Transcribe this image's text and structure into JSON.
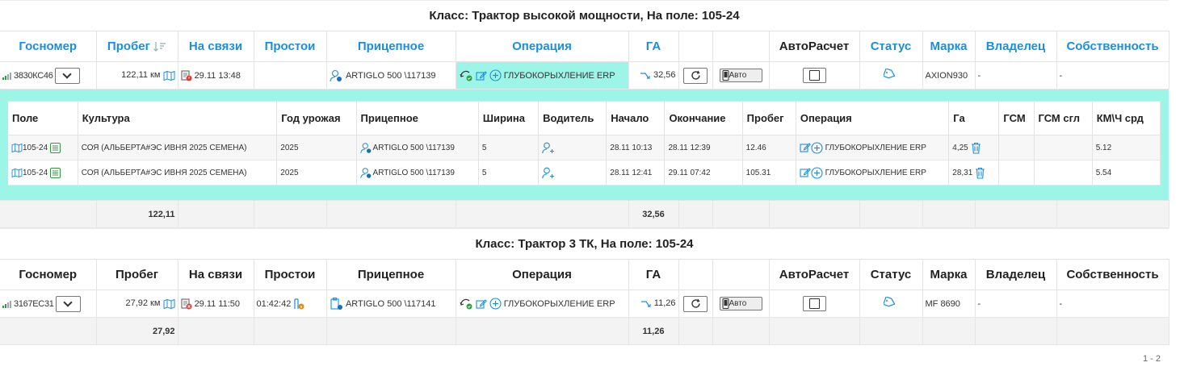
{
  "groups": [
    {
      "title": "Класс: Трактор высокой мощности, На поле: 105-24",
      "headers": {
        "gosnomer": "Госномер",
        "probeg": "Пробег",
        "na_svyazi": "На связи",
        "prostoi": "Простои",
        "pricepnoe": "Прицепное",
        "operaciya": "Операция",
        "ga": "ГА",
        "autocalc": "АвтоРасчет",
        "status": "Статус",
        "marka": "Марка",
        "vladelec": "Владелец",
        "sobstvennost": "Собственность"
      },
      "row": {
        "plate": "3830КС46",
        "probeg": "122,11 км",
        "na_svyazi": "29.11 13:48",
        "prostoi": "",
        "pricepnoe": "ARTIGLO 500 \\117139",
        "operaciya": "ГЛУБОКОРЫХЛЕНИЕ ERP",
        "ga": "32,56",
        "auto_label": "Авто",
        "marka": "AXION930",
        "vladelec": "-",
        "sobstvennost": "-"
      },
      "detail": {
        "headers": {
          "pole": "Поле",
          "kultura": "Культура",
          "god": "Год урожая",
          "pricepnoe": "Прицепное",
          "shirina": "Ширина",
          "voditel": "Водитель",
          "nachalo": "Начало",
          "okonchanie": "Окончание",
          "probeg": "Пробег",
          "operaciya": "Операция",
          "ga": "Га",
          "gsm": "ГСМ",
          "gsm_sgl": "ГСМ сгл",
          "kmch": "КМ\\Ч срд"
        },
        "rows": [
          {
            "pole": "105-24",
            "kultura": "СОЯ (АЛЬБЕРТА#ЭС ИВНЯ 2025 СЕМЕНА)",
            "god": "2025",
            "pricepnoe": "ARTIGLO 500 \\117139",
            "shirina": "5",
            "nachalo": "28.11 10:13",
            "okonchanie": "28.11 12:39",
            "probeg": "12.46",
            "operaciya": "ГЛУБОКОРЫХЛЕНИЕ ERP",
            "ga": "4,25",
            "gsm": "",
            "gsm_sgl": "",
            "kmch": "5.12"
          },
          {
            "pole": "105-24",
            "kultura": "СОЯ (АЛЬБЕРТА#ЭС ИВНЯ 2025 СЕМЕНА)",
            "god": "2025",
            "pricepnoe": "ARTIGLO 500 \\117139",
            "shirina": "5",
            "nachalo": "28.11 12:41",
            "okonchanie": "29.11 07:42",
            "probeg": "105.31",
            "operaciya": "ГЛУБОКОРЫХЛЕНИЕ ERP",
            "ga": "28,31",
            "gsm": "",
            "gsm_sgl": "",
            "kmch": "5.54"
          }
        ]
      },
      "totals": {
        "probeg": "122,11",
        "ga": "32,56"
      }
    },
    {
      "title": "Класс: Трактор 3 ТК, На поле: 105-24",
      "headers": {
        "gosnomer": "Госномер",
        "probeg": "Пробег",
        "na_svyazi": "На связи",
        "prostoi": "Простои",
        "pricepnoe": "Прицепное",
        "operaciya": "Операция",
        "ga": "ГА",
        "autocalc": "АвтоРасчет",
        "status": "Статус",
        "marka": "Марка",
        "vladelec": "Владелец",
        "sobstvennost": "Собственность"
      },
      "row": {
        "plate": "3167ЕС31",
        "probeg": "27,92 км",
        "na_svyazi": "29.11 11:50",
        "prostoi": "01:42:42",
        "pricepnoe": "ARTIGLO 500 \\117141",
        "operaciya": "ГЛУБОКОРЫХЛЕНИЕ ERP",
        "ga": "11,26",
        "auto_label": "Авто",
        "marka": "MF 8690",
        "vladelec": "-",
        "sobstvennost": "-"
      },
      "totals": {
        "probeg": "27,92",
        "ga": "11,26"
      }
    }
  ],
  "pager": "1 - 2",
  "colors": {
    "accent": "#1a8fdb",
    "highlight": "#9df5e8",
    "alert": "#e53935",
    "ok": "#2e9b3f"
  }
}
